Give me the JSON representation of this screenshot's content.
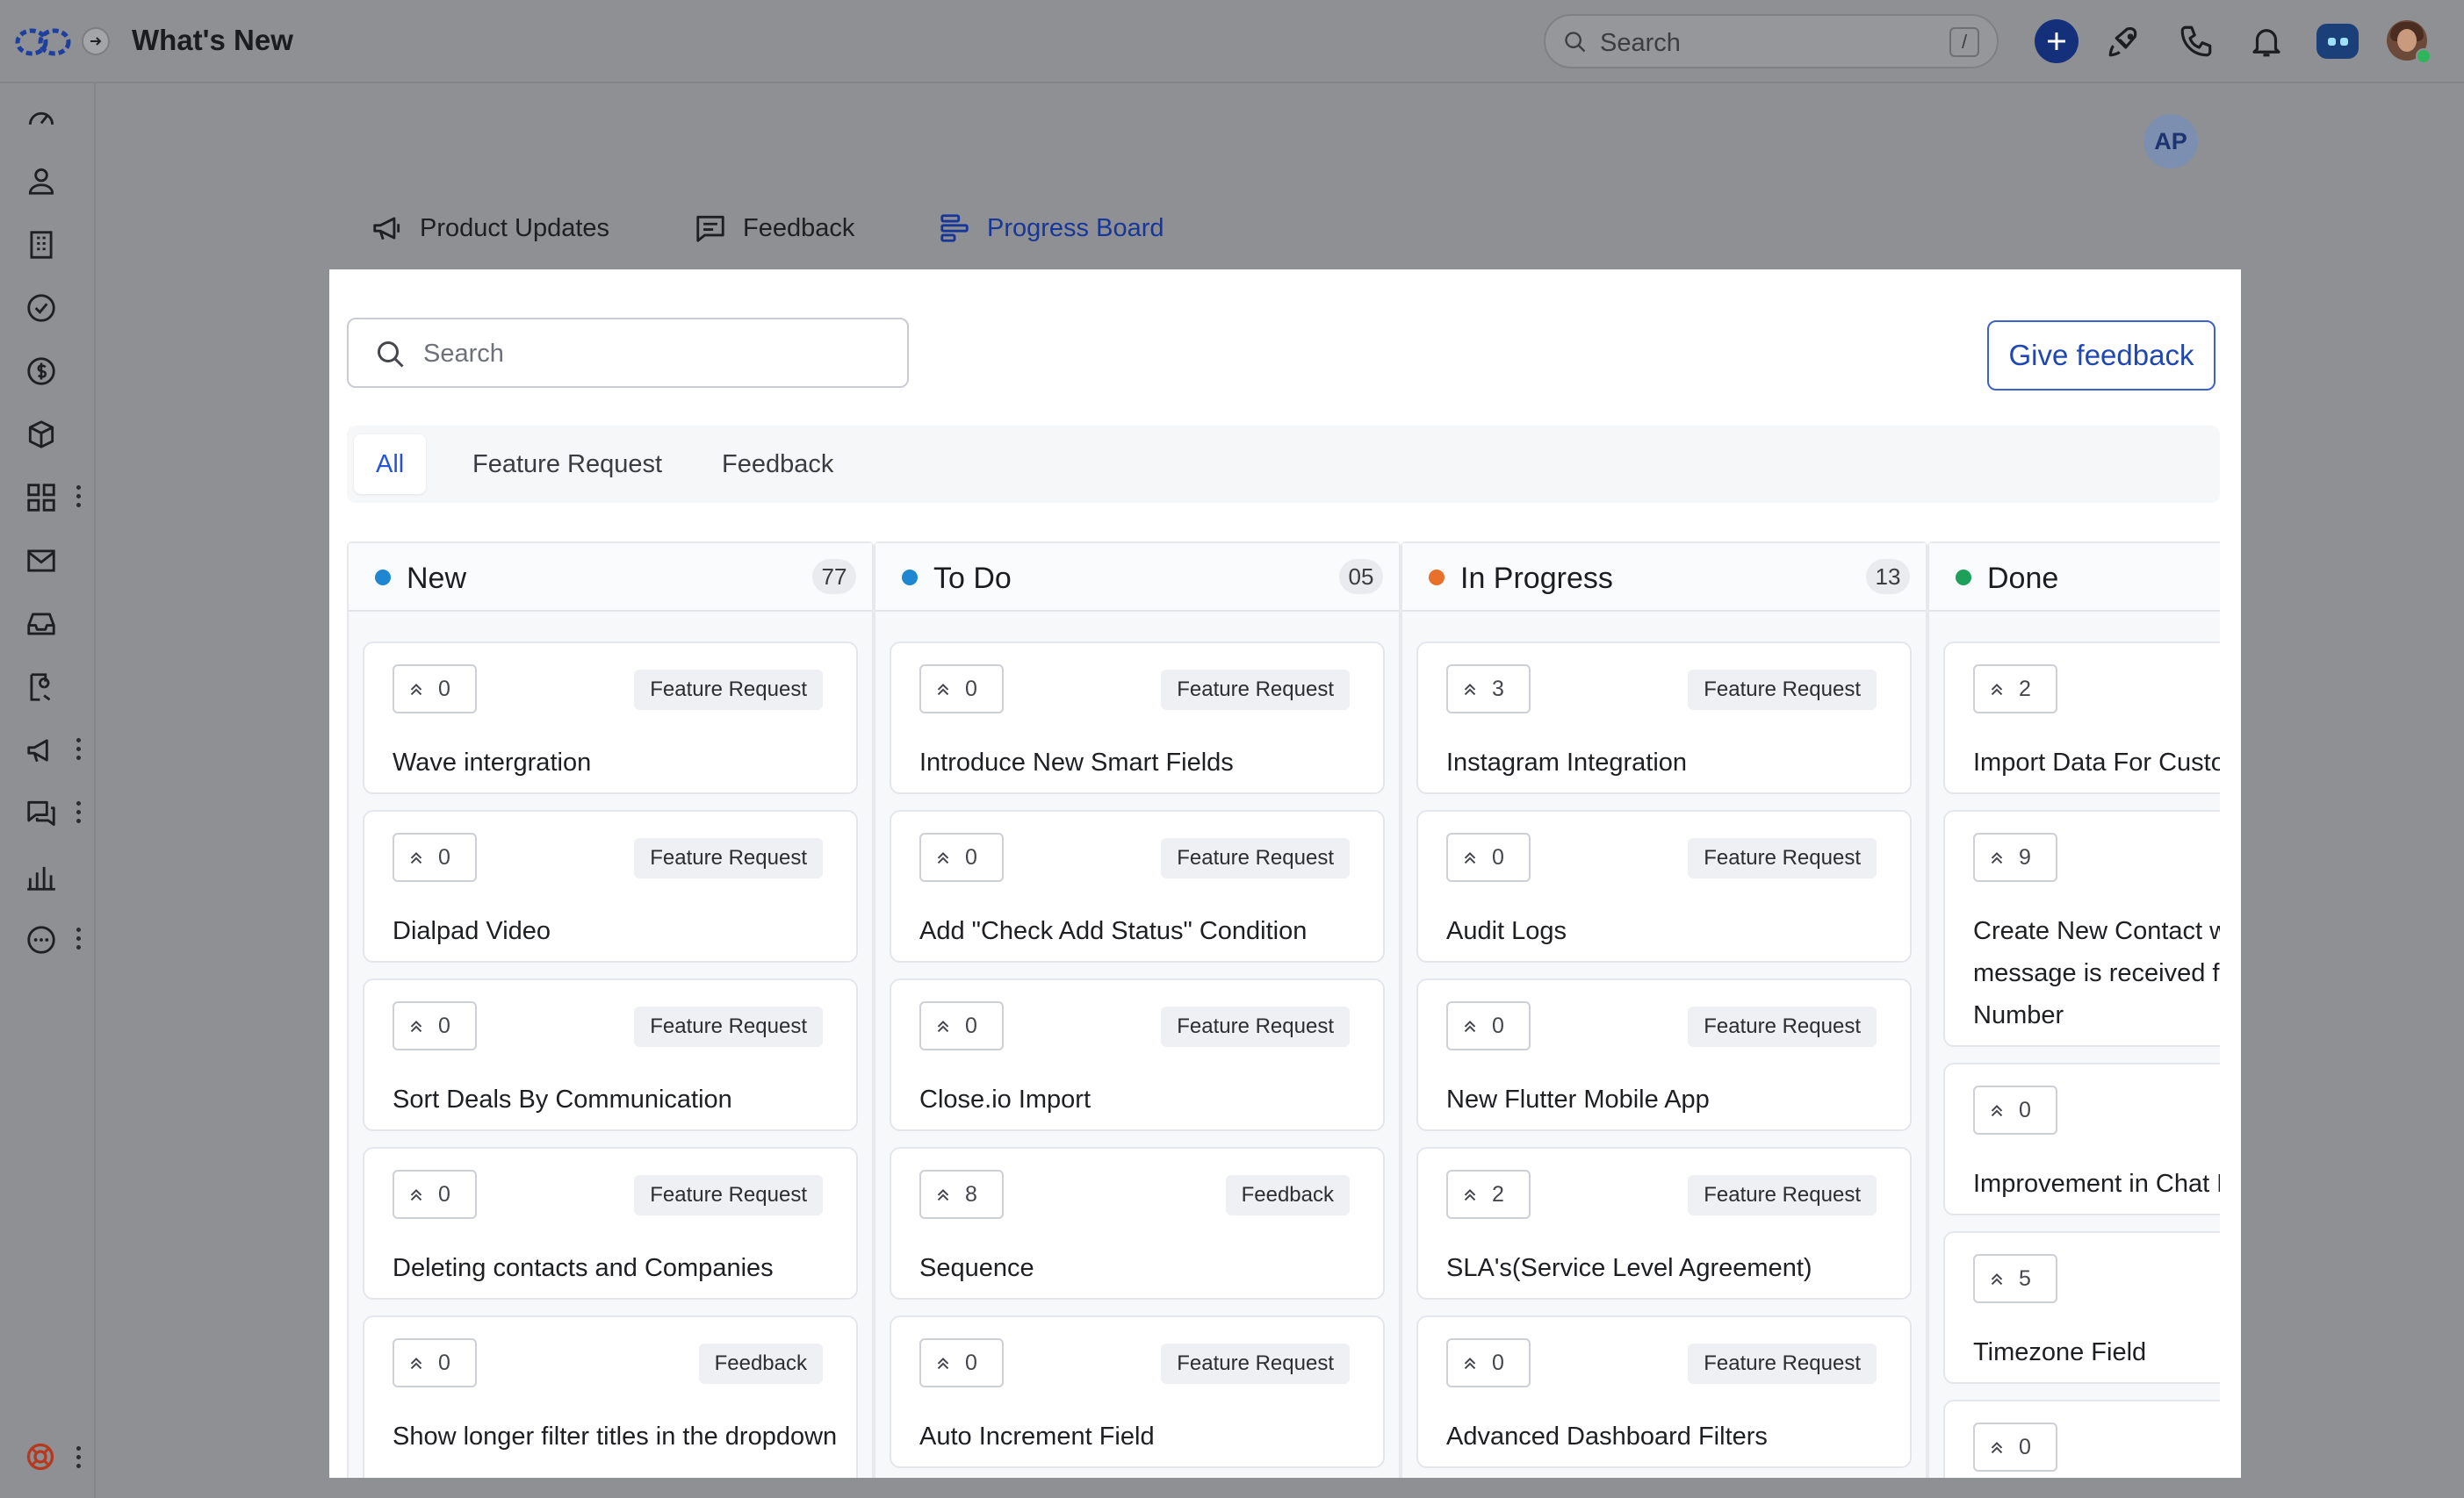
{
  "app": {
    "title": "What's New",
    "search_placeholder": "Search",
    "search_shortcut": "/",
    "user_initials": "AP"
  },
  "main_tabs": [
    {
      "label": "Product Updates",
      "icon": "megaphone-icon",
      "active": false
    },
    {
      "label": "Feedback",
      "icon": "message-square-icon",
      "active": false
    },
    {
      "label": "Progress Board",
      "icon": "kanban-icon",
      "active": true
    }
  ],
  "panel": {
    "search_placeholder": "Search",
    "give_feedback_label": "Give feedback",
    "filters": [
      {
        "label": "All",
        "active": true
      },
      {
        "label": "Feature Request",
        "active": false
      },
      {
        "label": "Feedback",
        "active": false
      }
    ]
  },
  "colors": {
    "accent": "#2654d6",
    "new": "#1f86d1",
    "todo": "#1f86d1",
    "in_progress": "#e8702a",
    "done": "#1ea05a"
  },
  "columns": [
    {
      "title": "New",
      "count": "77",
      "status": "new",
      "cards": [
        {
          "votes": "0",
          "tag": "Feature Request",
          "title": "Wave intergration"
        },
        {
          "votes": "0",
          "tag": "Feature Request",
          "title": "Dialpad Video"
        },
        {
          "votes": "0",
          "tag": "Feature Request",
          "title": "Sort Deals By Communication"
        },
        {
          "votes": "0",
          "tag": "Feature Request",
          "title": "Deleting contacts and Companies"
        },
        {
          "votes": "0",
          "tag": "Feedback",
          "title": "Show longer filter titles in the dropdown"
        }
      ]
    },
    {
      "title": "To Do",
      "count": "05",
      "status": "todo",
      "cards": [
        {
          "votes": "0",
          "tag": "Feature Request",
          "title": "Introduce New Smart Fields"
        },
        {
          "votes": "0",
          "tag": "Feature Request",
          "title": "Add \"Check Add Status\" Condition"
        },
        {
          "votes": "0",
          "tag": "Feature Request",
          "title": "Close.io Import"
        },
        {
          "votes": "8",
          "tag": "Feedback",
          "title": "Sequence"
        },
        {
          "votes": "0",
          "tag": "Feature Request",
          "title": "Auto Increment Field"
        }
      ]
    },
    {
      "title": "In Progress",
      "count": "13",
      "status": "in_progress",
      "cards": [
        {
          "votes": "3",
          "tag": "Feature Request",
          "title": "Instagram Integration"
        },
        {
          "votes": "0",
          "tag": "Feature Request",
          "title": "Audit Logs"
        },
        {
          "votes": "0",
          "tag": "Feature Request",
          "title": "New Flutter Mobile App"
        },
        {
          "votes": "2",
          "tag": "Feature Request",
          "title": "SLA's(Service Level Agreement)"
        },
        {
          "votes": "0",
          "tag": "Feature Request",
          "title": "Advanced Dashboard Filters"
        }
      ]
    },
    {
      "title": "Done",
      "count": "",
      "status": "done",
      "cards": [
        {
          "votes": "2",
          "tag": "",
          "title": "Import Data For Custo"
        },
        {
          "votes": "9",
          "tag": "",
          "title": "Create New Contact w message is received fr Number"
        },
        {
          "votes": "0",
          "tag": "",
          "title": "Improvement in Chat F"
        },
        {
          "votes": "5",
          "tag": "",
          "title": "Timezone Field"
        },
        {
          "votes": "0",
          "tag": "",
          "title": ""
        }
      ]
    }
  ]
}
